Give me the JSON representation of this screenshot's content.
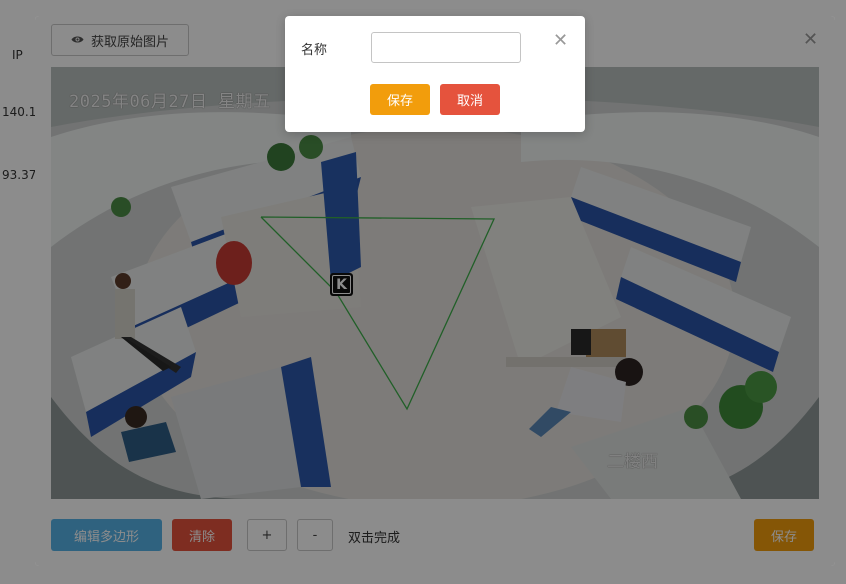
{
  "background": {
    "column_header": "IP",
    "rows": [
      "140.1",
      "93.37"
    ]
  },
  "editor": {
    "get_image_button": "获取原始图片",
    "close_icon": "close-icon",
    "camera": {
      "timestamp": "2025年06月27日  星期五",
      "location_label": "二楼西",
      "marker_letter": "K"
    },
    "toolbar": {
      "edit_polygon": "编辑多边形",
      "clear": "清除",
      "zoom_in": "+",
      "zoom_out": "-",
      "hint": "双击完成",
      "save": "保存"
    }
  },
  "dialog": {
    "name_label": "名称",
    "name_value": "",
    "name_placeholder": "",
    "save_label": "保存",
    "cancel_label": "取消"
  },
  "colors": {
    "primary_blue": "#57b3e8",
    "danger_red": "#e5533d",
    "warning_orange": "#f29d0c",
    "polygon_green": "#3cae4a"
  }
}
